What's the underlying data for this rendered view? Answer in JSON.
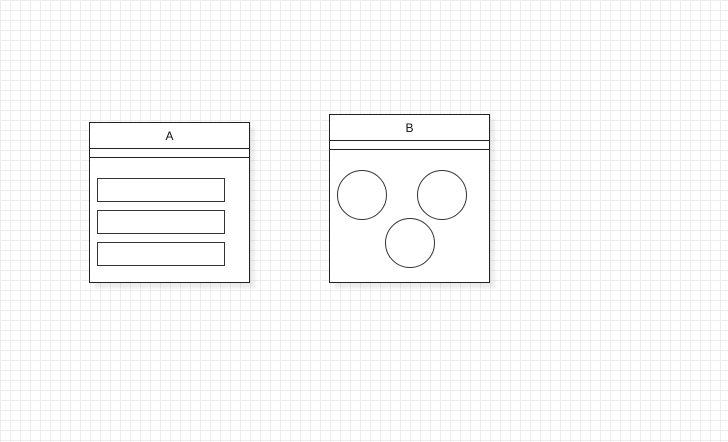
{
  "diagram": {
    "box_a": {
      "title": "A",
      "fields": [
        "",
        "",
        ""
      ]
    },
    "box_b": {
      "title": "B",
      "circles": [
        "",
        "",
        ""
      ]
    }
  },
  "colors": {
    "stroke": "#222222",
    "grid": "#ededed",
    "background": "#ffffff"
  }
}
